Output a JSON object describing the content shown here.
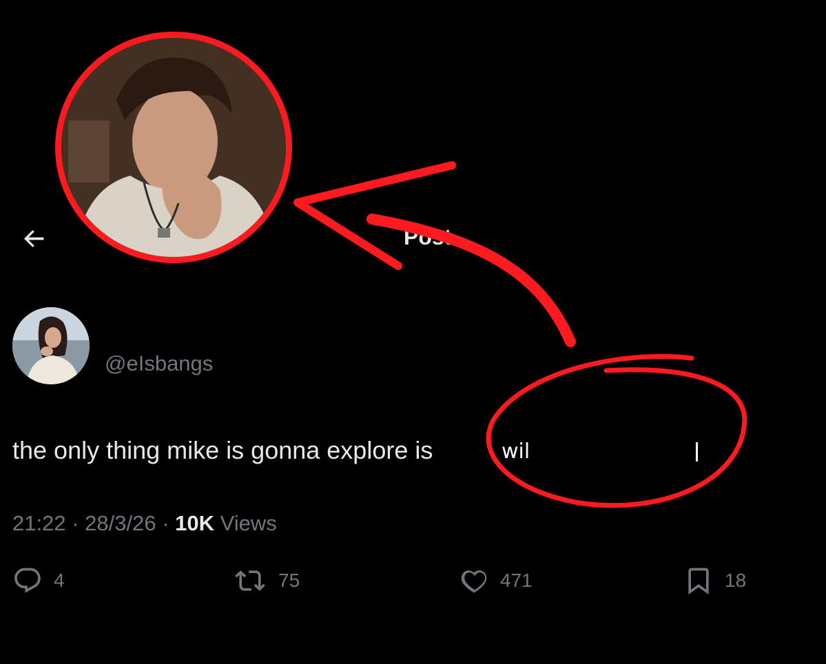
{
  "header": {
    "title": "Post",
    "back_icon": "arrow-left-icon"
  },
  "author": {
    "handle": "@eIsbangs",
    "avatar_icon": "profile-photo"
  },
  "post": {
    "text": "the only thing mike is gonna explore is",
    "typed_text": "wil",
    "time": "21:22",
    "date": "28/3/26",
    "views_count": "10K",
    "views_label": "Views",
    "separator": "·"
  },
  "actions": {
    "replies": "4",
    "reposts": "75",
    "likes": "471",
    "bookmarks": "18"
  },
  "colors": {
    "background": "#000000",
    "text": "#e7e9ea",
    "muted": "#71767b",
    "annotation": "#ff1a1f"
  }
}
